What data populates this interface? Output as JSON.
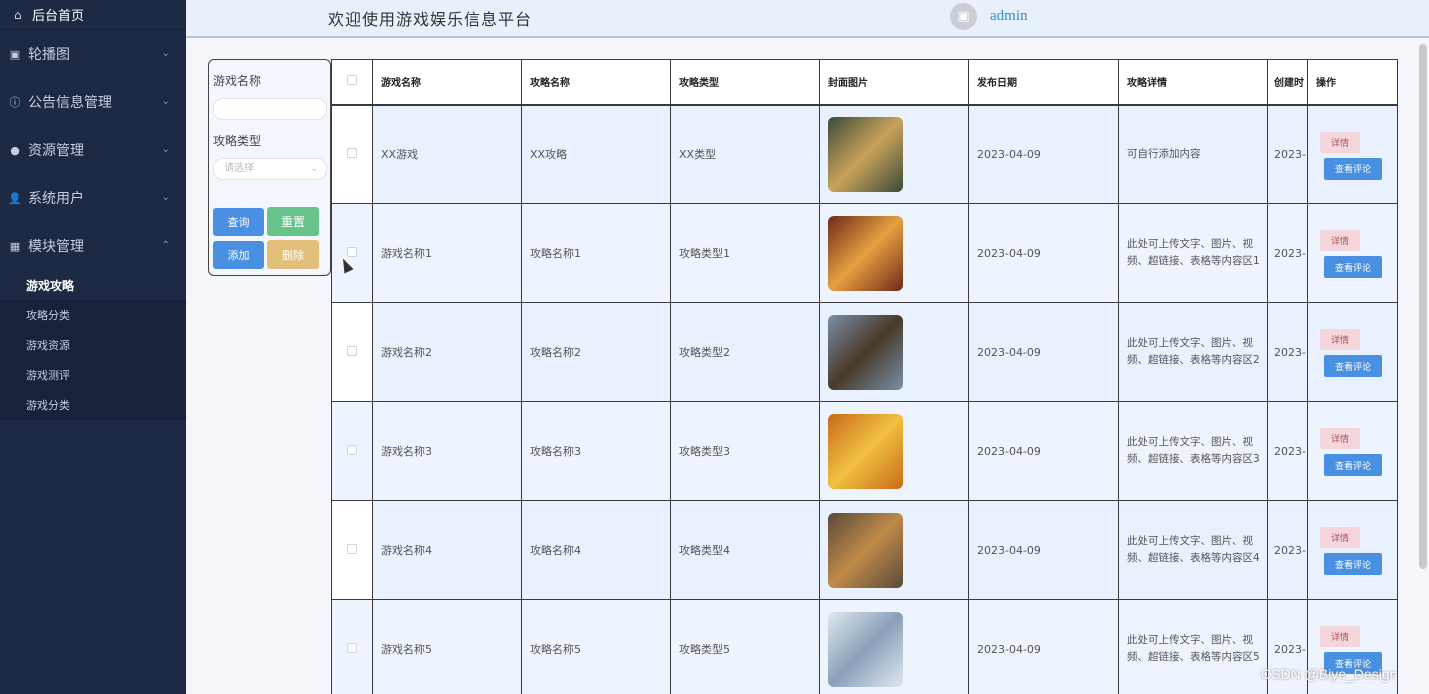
{
  "sidebar": {
    "home": "后台首页",
    "groups": [
      {
        "label": "轮播图",
        "icon": "image-icon"
      },
      {
        "label": "公告信息管理",
        "icon": "info-icon"
      },
      {
        "label": "资源管理",
        "icon": "pin-icon"
      },
      {
        "label": "系统用户",
        "icon": "user-icon"
      },
      {
        "label": "模块管理",
        "icon": "grid-icon"
      }
    ],
    "sub_items": [
      "游戏攻略",
      "攻略分类",
      "游戏资源",
      "游戏测评",
      "游戏分类"
    ]
  },
  "header": {
    "title": "欢迎使用游戏娱乐信息平台",
    "username": "admin"
  },
  "search": {
    "name_label": "游戏名称",
    "type_label": "攻略类型",
    "type_placeholder": "请选择",
    "query": "查询",
    "reset": "重置",
    "add": "添加",
    "delete": "删除"
  },
  "table": {
    "headers": [
      "游戏名称",
      "攻略名称",
      "攻略类型",
      "封面图片",
      "发布日期",
      "攻略详情",
      "创建时",
      "操作"
    ],
    "detail_btn": "详情",
    "comment_btn": "查看评论",
    "rows": [
      {
        "game": "XX游戏",
        "guide": "XX攻略",
        "type": "XX类型",
        "date": "2023-04-09",
        "detail": "可自行添加内容",
        "created": "2023-"
      },
      {
        "game": "游戏名称1",
        "guide": "攻略名称1",
        "type": "攻略类型1",
        "date": "2023-04-09",
        "detail": "此处可上传文字、图片、视频、超链接、表格等内容区1",
        "created": "2023-"
      },
      {
        "game": "游戏名称2",
        "guide": "攻略名称2",
        "type": "攻略类型2",
        "date": "2023-04-09",
        "detail": "此处可上传文字、图片、视频、超链接、表格等内容区2",
        "created": "2023-"
      },
      {
        "game": "游戏名称3",
        "guide": "攻略名称3",
        "type": "攻略类型3",
        "date": "2023-04-09",
        "detail": "此处可上传文字、图片、视频、超链接、表格等内容区3",
        "created": "2023-"
      },
      {
        "game": "游戏名称4",
        "guide": "攻略名称4",
        "type": "攻略类型4",
        "date": "2023-04-09",
        "detail": "此处可上传文字、图片、视频、超链接、表格等内容区4",
        "created": "2023-"
      },
      {
        "game": "游戏名称5",
        "guide": "攻略名称5",
        "type": "攻略类型5",
        "date": "2023-04-09",
        "detail": "此处可上传文字、图片、视频、超链接、表格等内容区5",
        "created": "2023-"
      }
    ]
  },
  "cover_colors": [
    [
      "#3a4a3a",
      "#c9a35a"
    ],
    [
      "#6b2a1a",
      "#e8a040"
    ],
    [
      "#7a8fa8",
      "#4a3a2a"
    ],
    [
      "#c86a1a",
      "#f0c040"
    ],
    [
      "#5a4a3a",
      "#c08a4a"
    ],
    [
      "#dfe8f0",
      "#8aa0b8"
    ]
  ],
  "watermark": "CSDN @Biye_Design"
}
